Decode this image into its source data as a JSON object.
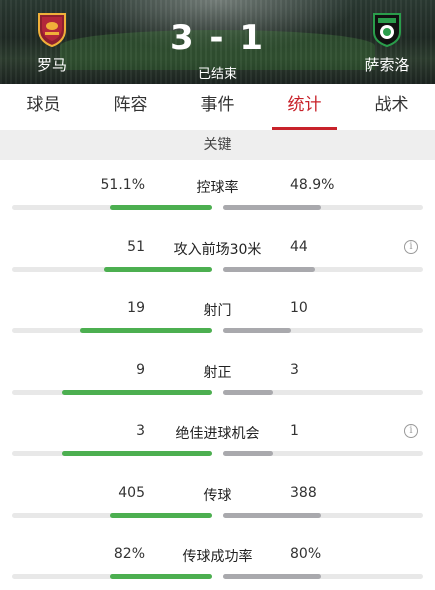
{
  "match": {
    "home_team": "罗马",
    "away_team": "萨索洛",
    "score": "3 - 1",
    "status": "已结束"
  },
  "tabs": [
    {
      "label": "球员",
      "active": false
    },
    {
      "label": "阵容",
      "active": false
    },
    {
      "label": "事件",
      "active": false
    },
    {
      "label": "统计",
      "active": true
    },
    {
      "label": "战术",
      "active": false
    }
  ],
  "section_title": "关键",
  "colors": {
    "accent": "#c8222a",
    "home_bar": "#4caf50",
    "away_bar": "#a9a9ad"
  },
  "stats": [
    {
      "label": "控球率",
      "home": "51.1%",
      "away": "48.9%",
      "home_share": 0.511,
      "away_share": 0.489,
      "info": false
    },
    {
      "label": "攻入前场30米",
      "home": "51",
      "away": "44",
      "home_share": 0.54,
      "away_share": 0.46,
      "info": true
    },
    {
      "label": "射门",
      "home": "19",
      "away": "10",
      "home_share": 0.66,
      "away_share": 0.34,
      "info": false
    },
    {
      "label": "射正",
      "home": "9",
      "away": "3",
      "home_share": 0.75,
      "away_share": 0.25,
      "info": false
    },
    {
      "label": "绝佳进球机会",
      "home": "3",
      "away": "1",
      "home_share": 0.75,
      "away_share": 0.25,
      "info": true
    },
    {
      "label": "传球",
      "home": "405",
      "away": "388",
      "home_share": 0.51,
      "away_share": 0.49,
      "info": false
    },
    {
      "label": "传球成功率",
      "home": "82%",
      "away": "80%",
      "home_share": 0.51,
      "away_share": 0.49,
      "info": false
    }
  ],
  "icons": {
    "home_badge": "roma-badge-icon",
    "away_badge": "sassuolo-badge-icon",
    "info": "info-icon"
  }
}
